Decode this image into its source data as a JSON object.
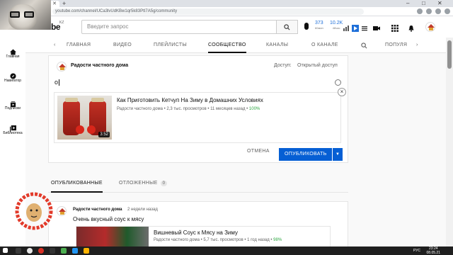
{
  "browser": {
    "url": "youtube.com/channel/UCa3lvUdKBw1qr5k83PtI7A5g/community",
    "new_tab": "+",
    "window_controls": [
      "–",
      "□",
      "✕"
    ]
  },
  "header": {
    "logo_tail": "be",
    "logo_region": "KZ",
    "search_placeholder": "Введите запрос",
    "stat1_value": "373",
    "stat1_label": "60мин",
    "stat2_value": "10.2K",
    "stat2_label": "48час"
  },
  "guide": {
    "items": [
      {
        "label": "Главная",
        "icon": "home-icon"
      },
      {
        "label": "Навигатор",
        "icon": "compass-icon"
      },
      {
        "label": "Подписки",
        "icon": "subscriptions-icon"
      },
      {
        "label": "Библиотека",
        "icon": "library-icon"
      }
    ]
  },
  "channel_tabs": {
    "tabs": [
      "ГЛАВНАЯ",
      "ВИДЕО",
      "ПЛЕЙЛИСТЫ",
      "СООБЩЕСТВО",
      "КАНАЛЫ",
      "О КАНАЛЕ",
      "ПОПУЛЯ"
    ],
    "active": "СООБЩЕСТВО"
  },
  "composer": {
    "channel_name": "Радости частного дома",
    "access_label": "Доступ:",
    "access_value": "Открытый доступ",
    "text": "о",
    "attachment": {
      "title": "Как Приготовить Кетчуп На Зиму в Домашних Условиях",
      "meta": "Радости частного дома • 2,3 тыс. просмотров • 11 месяцев назад •",
      "percent": "100%",
      "duration": "3:52"
    },
    "cancel_label": "ОТМЕНА",
    "publish_label": "ОПУБЛИКОВАТЬ"
  },
  "posts_tabs": {
    "published": "ОПУБЛИКОВАННЫЕ",
    "scheduled": "ОТЛОЖЕННЫЕ",
    "scheduled_count": "0"
  },
  "post": {
    "author": "Радости частного дома",
    "time": "2 недели назад",
    "text": "Очень вкусный соус к мясу",
    "embed": {
      "title": "Вишневый Соус к Мясу на Зиму",
      "meta": "Радости частного дома • 5,7 тыс. просмотров • 1 год назад •",
      "percent": "98%"
    }
  },
  "taskbar": {
    "lang": "РУС",
    "time": "23:24",
    "date": "08.05.21"
  },
  "colors": {
    "accent_blue": "#065fd4",
    "stat_blue": "#1e6fd9",
    "percent_green": "#2ba640"
  }
}
